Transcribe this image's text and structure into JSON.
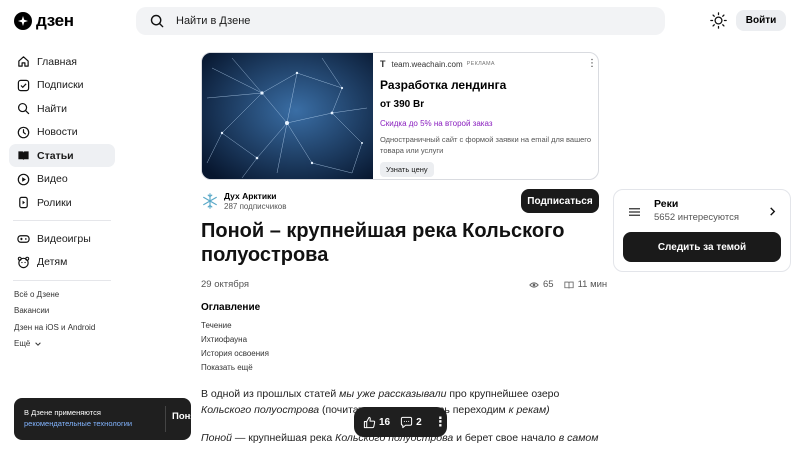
{
  "header": {
    "logo_text": "дзен",
    "search_placeholder": "Найти в Дзене",
    "login_label": "Войти"
  },
  "sidebar": {
    "items": [
      {
        "label": "Главная",
        "icon": "home-icon"
      },
      {
        "label": "Подписки",
        "icon": "subscriptions-icon"
      },
      {
        "label": "Найти",
        "icon": "search-icon"
      },
      {
        "label": "Новости",
        "icon": "news-icon"
      },
      {
        "label": "Статьи",
        "icon": "articles-icon",
        "active": true
      },
      {
        "label": "Видео",
        "icon": "video-icon"
      },
      {
        "label": "Ролики",
        "icon": "shorts-icon"
      }
    ],
    "secondary": [
      {
        "label": "Видеоигры",
        "icon": "gamepad-icon"
      },
      {
        "label": "Детям",
        "icon": "kids-icon"
      }
    ],
    "footer_links": [
      "Всё о Дзене",
      "Вакансии",
      "Дзен на iOS и Android",
      "Ещё"
    ]
  },
  "ad": {
    "domain": "team.weachain.com",
    "tag": "РЕКЛАМА",
    "title": "Разработка лендинга",
    "price": "от 390 Br",
    "discount": "Скидка до 5% на второй заказ",
    "description": "Одностраничный сайт с формой заявки на email для вашего товара или услуги",
    "cta": "Узнать цену"
  },
  "author": {
    "name": "Дух Арктики",
    "subscribers": "287 подписчиков",
    "subscribe_label": "Подписаться"
  },
  "article": {
    "title": "Поной – крупнейшая река Кольского полуострова",
    "date": "29 октября",
    "views": "65",
    "read_time": "11 мин",
    "toc_title": "Оглавление",
    "toc": [
      "Течение",
      "Ихтиофауна",
      "История освоения",
      "Показать ещё"
    ],
    "p1_a": "В одной из прошлых статей ",
    "p1_b": "мы уже рассказывали",
    "p1_c": " про крупнейшее озеро",
    "p2_a": "Кольского полуострова",
    "p2_b": " (почитать",
    "p2_c": "ерь переходим ",
    "p2_d": "к рекам)",
    "p3_a": "Поной",
    "p3_b": " — крупнейшая река ",
    "p3_c": "Кольского полуострова",
    "p3_d": " и берет свое начало ",
    "p3_e": "в самом"
  },
  "topic": {
    "name": "Реки",
    "count": "5652 интересуются",
    "follow_label": "Следить за темой"
  },
  "cookie": {
    "line1": "В Дзене применяются",
    "line2": "рекомендательные технологии",
    "ok_label": "Понятно"
  },
  "reactions": {
    "likes": "16",
    "comments": "2"
  }
}
